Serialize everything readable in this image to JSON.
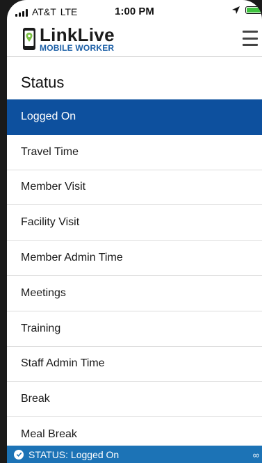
{
  "status_bar": {
    "carrier": "AT&T",
    "network": "LTE",
    "time": "1:00 PM",
    "battery_color": "#3fc33f"
  },
  "header": {
    "logo_name": "LinkLive",
    "logo_subtitle": "MOBILE WORKER",
    "menu_icon": "hamburger-menu-icon"
  },
  "page": {
    "title": "Status"
  },
  "status_list": {
    "items": [
      {
        "label": "Logged On",
        "active": true
      },
      {
        "label": "Travel Time",
        "active": false
      },
      {
        "label": "Member Visit",
        "active": false
      },
      {
        "label": "Facility Visit",
        "active": false
      },
      {
        "label": "Member Admin Time",
        "active": false
      },
      {
        "label": "Meetings",
        "active": false
      },
      {
        "label": "Training",
        "active": false
      },
      {
        "label": "Staff Admin Time",
        "active": false
      },
      {
        "label": "Break",
        "active": false
      },
      {
        "label": "Meal Break",
        "active": false
      }
    ]
  },
  "bottom_bar": {
    "status_text": "STATUS: Logged On",
    "accent": "#1c73b6"
  },
  "colors": {
    "active_row": "#0d509e",
    "brand_blue": "#1c5fa6",
    "logo_green": "#7bc043"
  }
}
